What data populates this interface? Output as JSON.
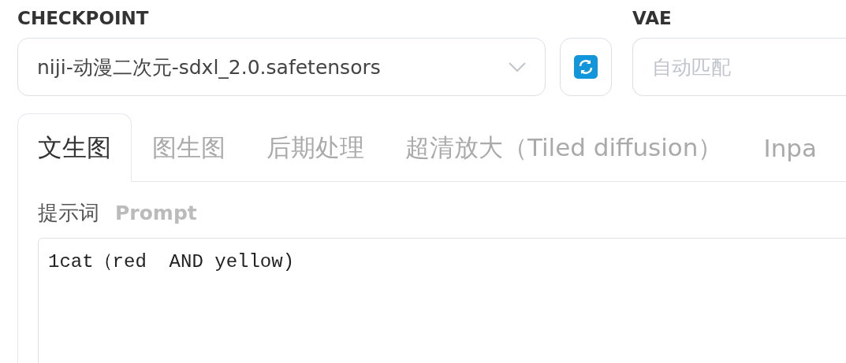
{
  "checkpoint": {
    "label": "CHECKPOINT",
    "value": "niji-动漫二次元-sdxl_2.0.safetensors"
  },
  "vae": {
    "label": "VAE",
    "placeholder": "自动匹配"
  },
  "tabs": [
    {
      "label": "文生图",
      "selected": true
    },
    {
      "label": "图生图",
      "selected": false
    },
    {
      "label": "后期处理",
      "selected": false
    },
    {
      "label": "超清放大（Tiled diffusion）",
      "selected": false
    },
    {
      "label": "Inpa",
      "selected": false
    }
  ],
  "prompt": {
    "label": "提示词",
    "hint": "Prompt",
    "value": "1cat（red  AND yellow)"
  }
}
